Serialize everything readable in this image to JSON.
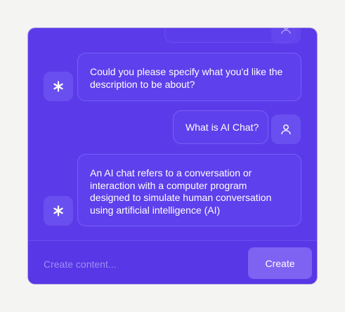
{
  "chat": {
    "messages": [
      {
        "role": "assistant",
        "text": "Could you please specify what you'd like the description to be about?"
      },
      {
        "role": "user",
        "text": "What is AI Chat?"
      },
      {
        "role": "assistant",
        "text": "An AI chat refers to a conversation or interaction with a computer program designed to simulate human conversation using artificial intelligence (AI)"
      }
    ]
  },
  "composer": {
    "placeholder": "Create content...",
    "button_label": "Create"
  },
  "icons": {
    "assistant_avatar": "asterisk-icon",
    "user_avatar": "user-icon"
  },
  "colors": {
    "panel_bg": "#5b3be9",
    "button_bg": "#7e63f2"
  }
}
